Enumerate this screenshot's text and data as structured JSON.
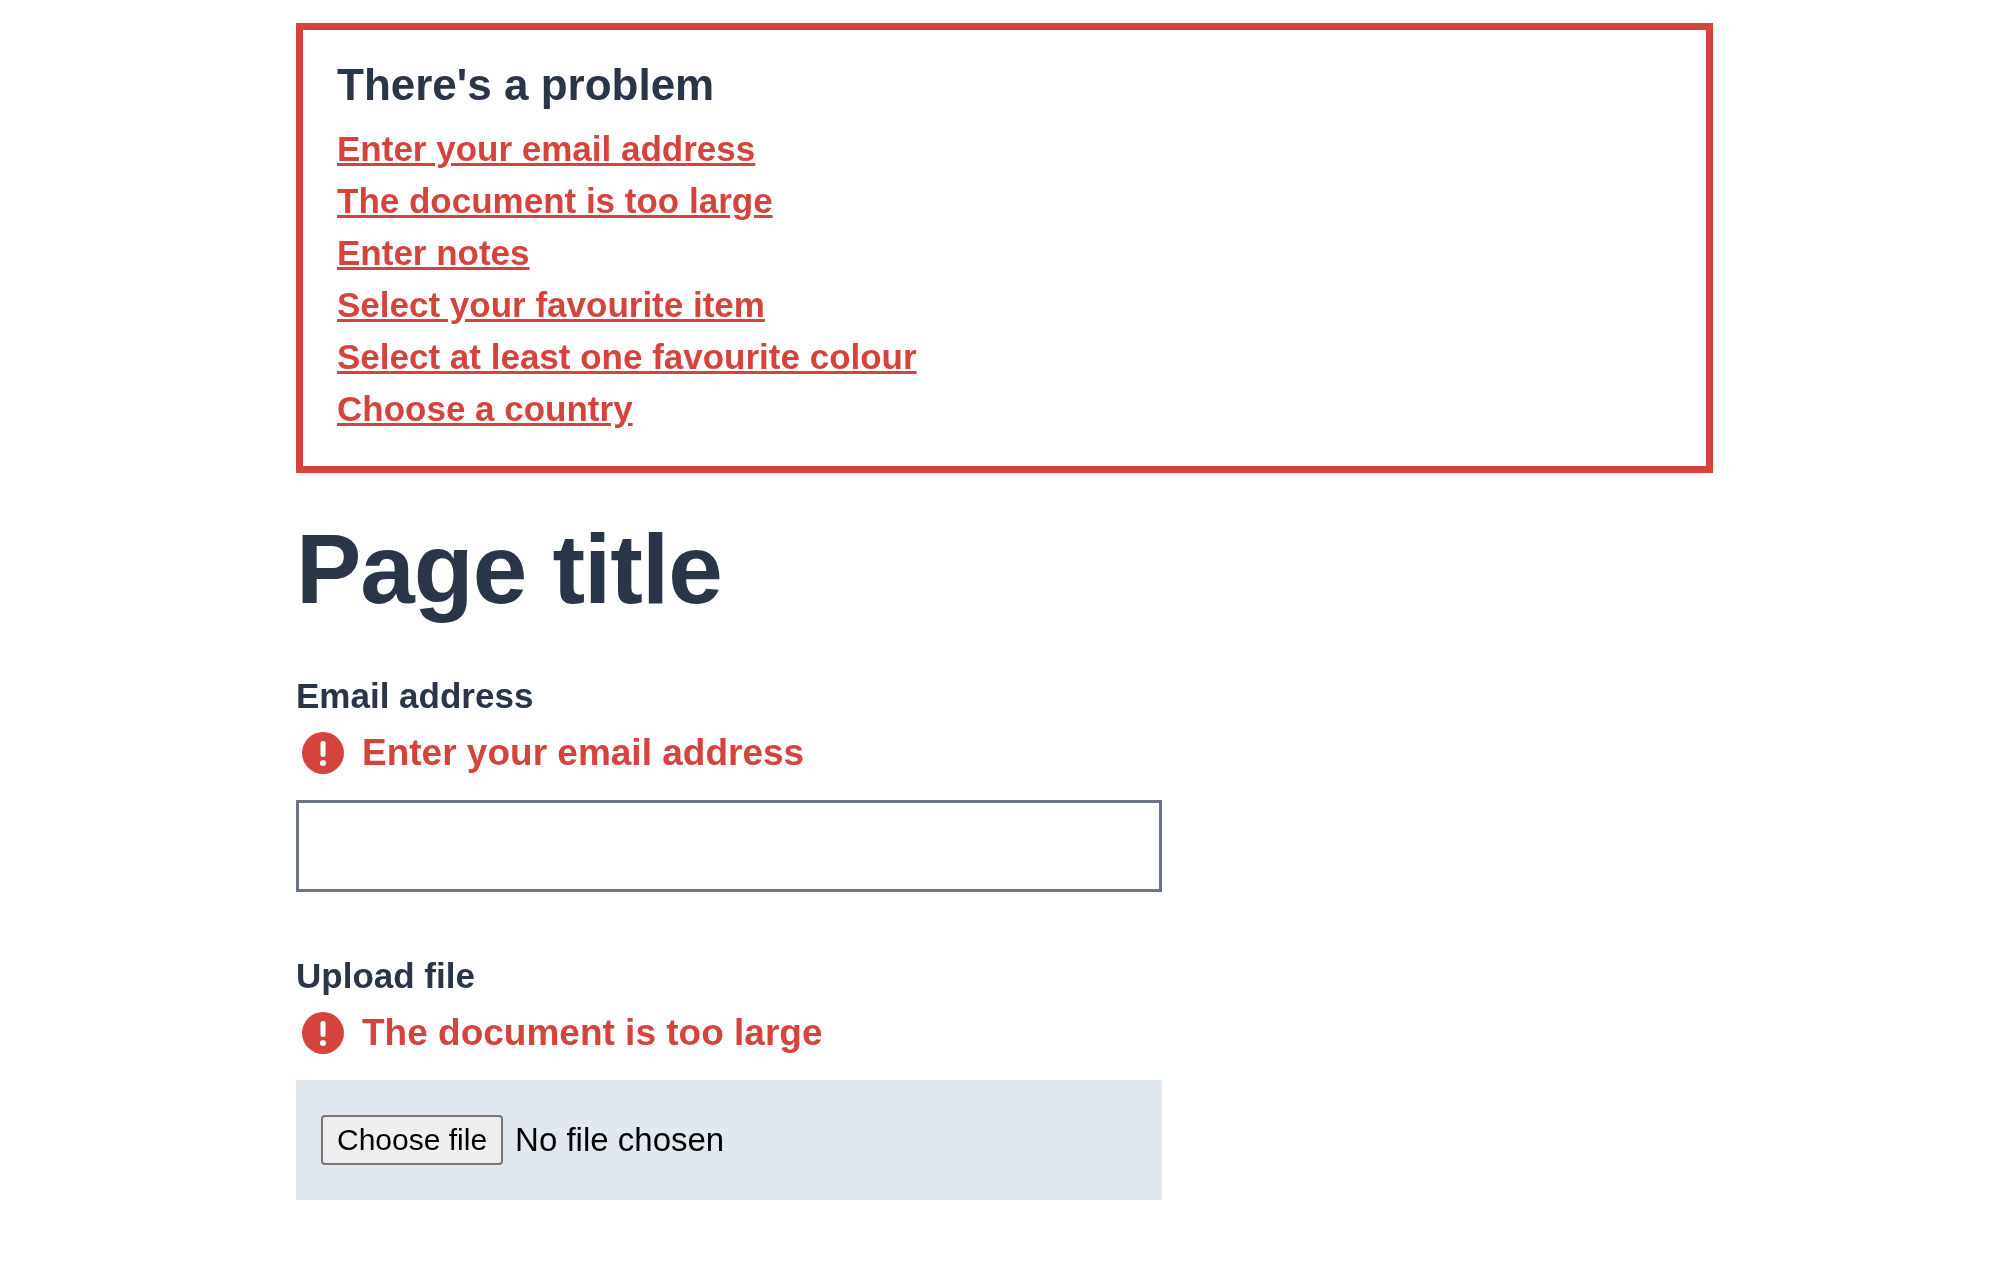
{
  "error_summary": {
    "title": "There's a problem",
    "links": [
      {
        "text": "Enter your email address"
      },
      {
        "text": "The document is too large"
      },
      {
        "text": "Enter notes"
      },
      {
        "text": "Select your favourite item"
      },
      {
        "text": "Select at least one favourite colour"
      },
      {
        "text": "Choose a country"
      }
    ]
  },
  "page_title": "Page title",
  "fields": [
    {
      "kind": "text",
      "label": "Email address",
      "error": "Enter your email address"
    },
    {
      "kind": "file",
      "label": "Upload file",
      "error": "The document is too large",
      "button": "Choose file",
      "status": "No file chosen"
    }
  ]
}
